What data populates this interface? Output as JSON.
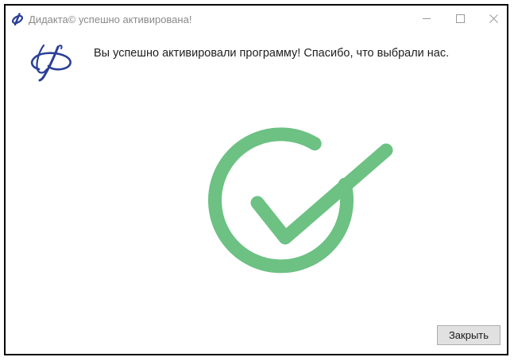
{
  "window": {
    "title": "Дидакта© успешно активирована!",
    "controls": {
      "minimize_icon": "minimize-icon",
      "maximize_icon": "maximize-icon",
      "close_icon": "close-icon"
    }
  },
  "content": {
    "logo_icon": "didakta-logo-icon",
    "message": "Вы успешно активировали программу! Спасибо, что выбрали нас.",
    "status_icon": "success-checkmark-icon"
  },
  "footer": {
    "close_button_label": "Закрыть"
  },
  "colors": {
    "success_green": "#6cc183",
    "logo_blue": "#2a3f97",
    "title_text": "#8a8a8a",
    "button_face": "#e1e1e1",
    "button_border": "#adadad"
  }
}
